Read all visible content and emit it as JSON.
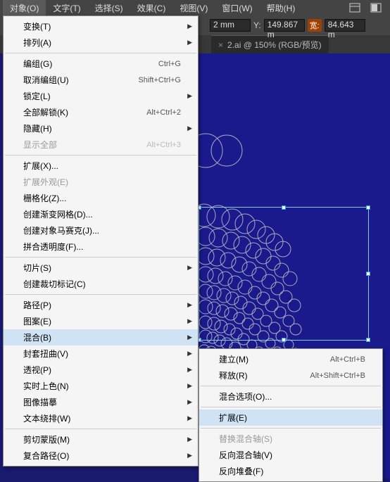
{
  "menubar": {
    "items": [
      "对象(O)",
      "文字(T)",
      "选择(S)",
      "效果(C)",
      "视图(V)",
      "窗口(W)",
      "帮助(H)"
    ]
  },
  "toolbar": {
    "x_suffix": "2 mm",
    "y_label": "Y:",
    "y_value": "149.867 m",
    "w_label": "宽:",
    "w_value": "84.643 m"
  },
  "tab": {
    "close": "×",
    "title": "2.ai @ 150% (RGB/预览)"
  },
  "menu": {
    "transform": "变换(T)",
    "arrange": "排列(A)",
    "group": "编组(G)",
    "group_key": "Ctrl+G",
    "ungroup": "取消编组(U)",
    "ungroup_key": "Shift+Ctrl+G",
    "lock": "锁定(L)",
    "unlock": "全部解锁(K)",
    "unlock_key": "Alt+Ctrl+2",
    "hide": "隐藏(H)",
    "showall": "显示全部",
    "showall_key": "Alt+Ctrl+3",
    "expand": "扩展(X)...",
    "expapp": "扩展外观(E)",
    "raster": "栅格化(Z)...",
    "gradmesh": "创建渐变网格(D)...",
    "mosaic": "创建对象马赛克(J)...",
    "flatten": "拼合透明度(F)...",
    "slice": "切片(S)",
    "trim": "创建裁切标记(C)",
    "path": "路径(P)",
    "pattern": "图案(E)",
    "blend": "混合(B)",
    "envelope": "封套扭曲(V)",
    "perspective": "透视(P)",
    "livepaint": "实时上色(N)",
    "trace": "图像描摹",
    "wrap": "文本绕排(W)",
    "clip": "剪切蒙版(M)",
    "compound": "复合路径(O)"
  },
  "submenu": {
    "make": "建立(M)",
    "make_key": "Alt+Ctrl+B",
    "release": "释放(R)",
    "release_key": "Alt+Shift+Ctrl+B",
    "options": "混合选项(O)...",
    "expand": "扩展(E)",
    "spine": "替换混合轴(S)",
    "revspine": "反向混合轴(V)",
    "revstack": "反向堆叠(F)"
  }
}
